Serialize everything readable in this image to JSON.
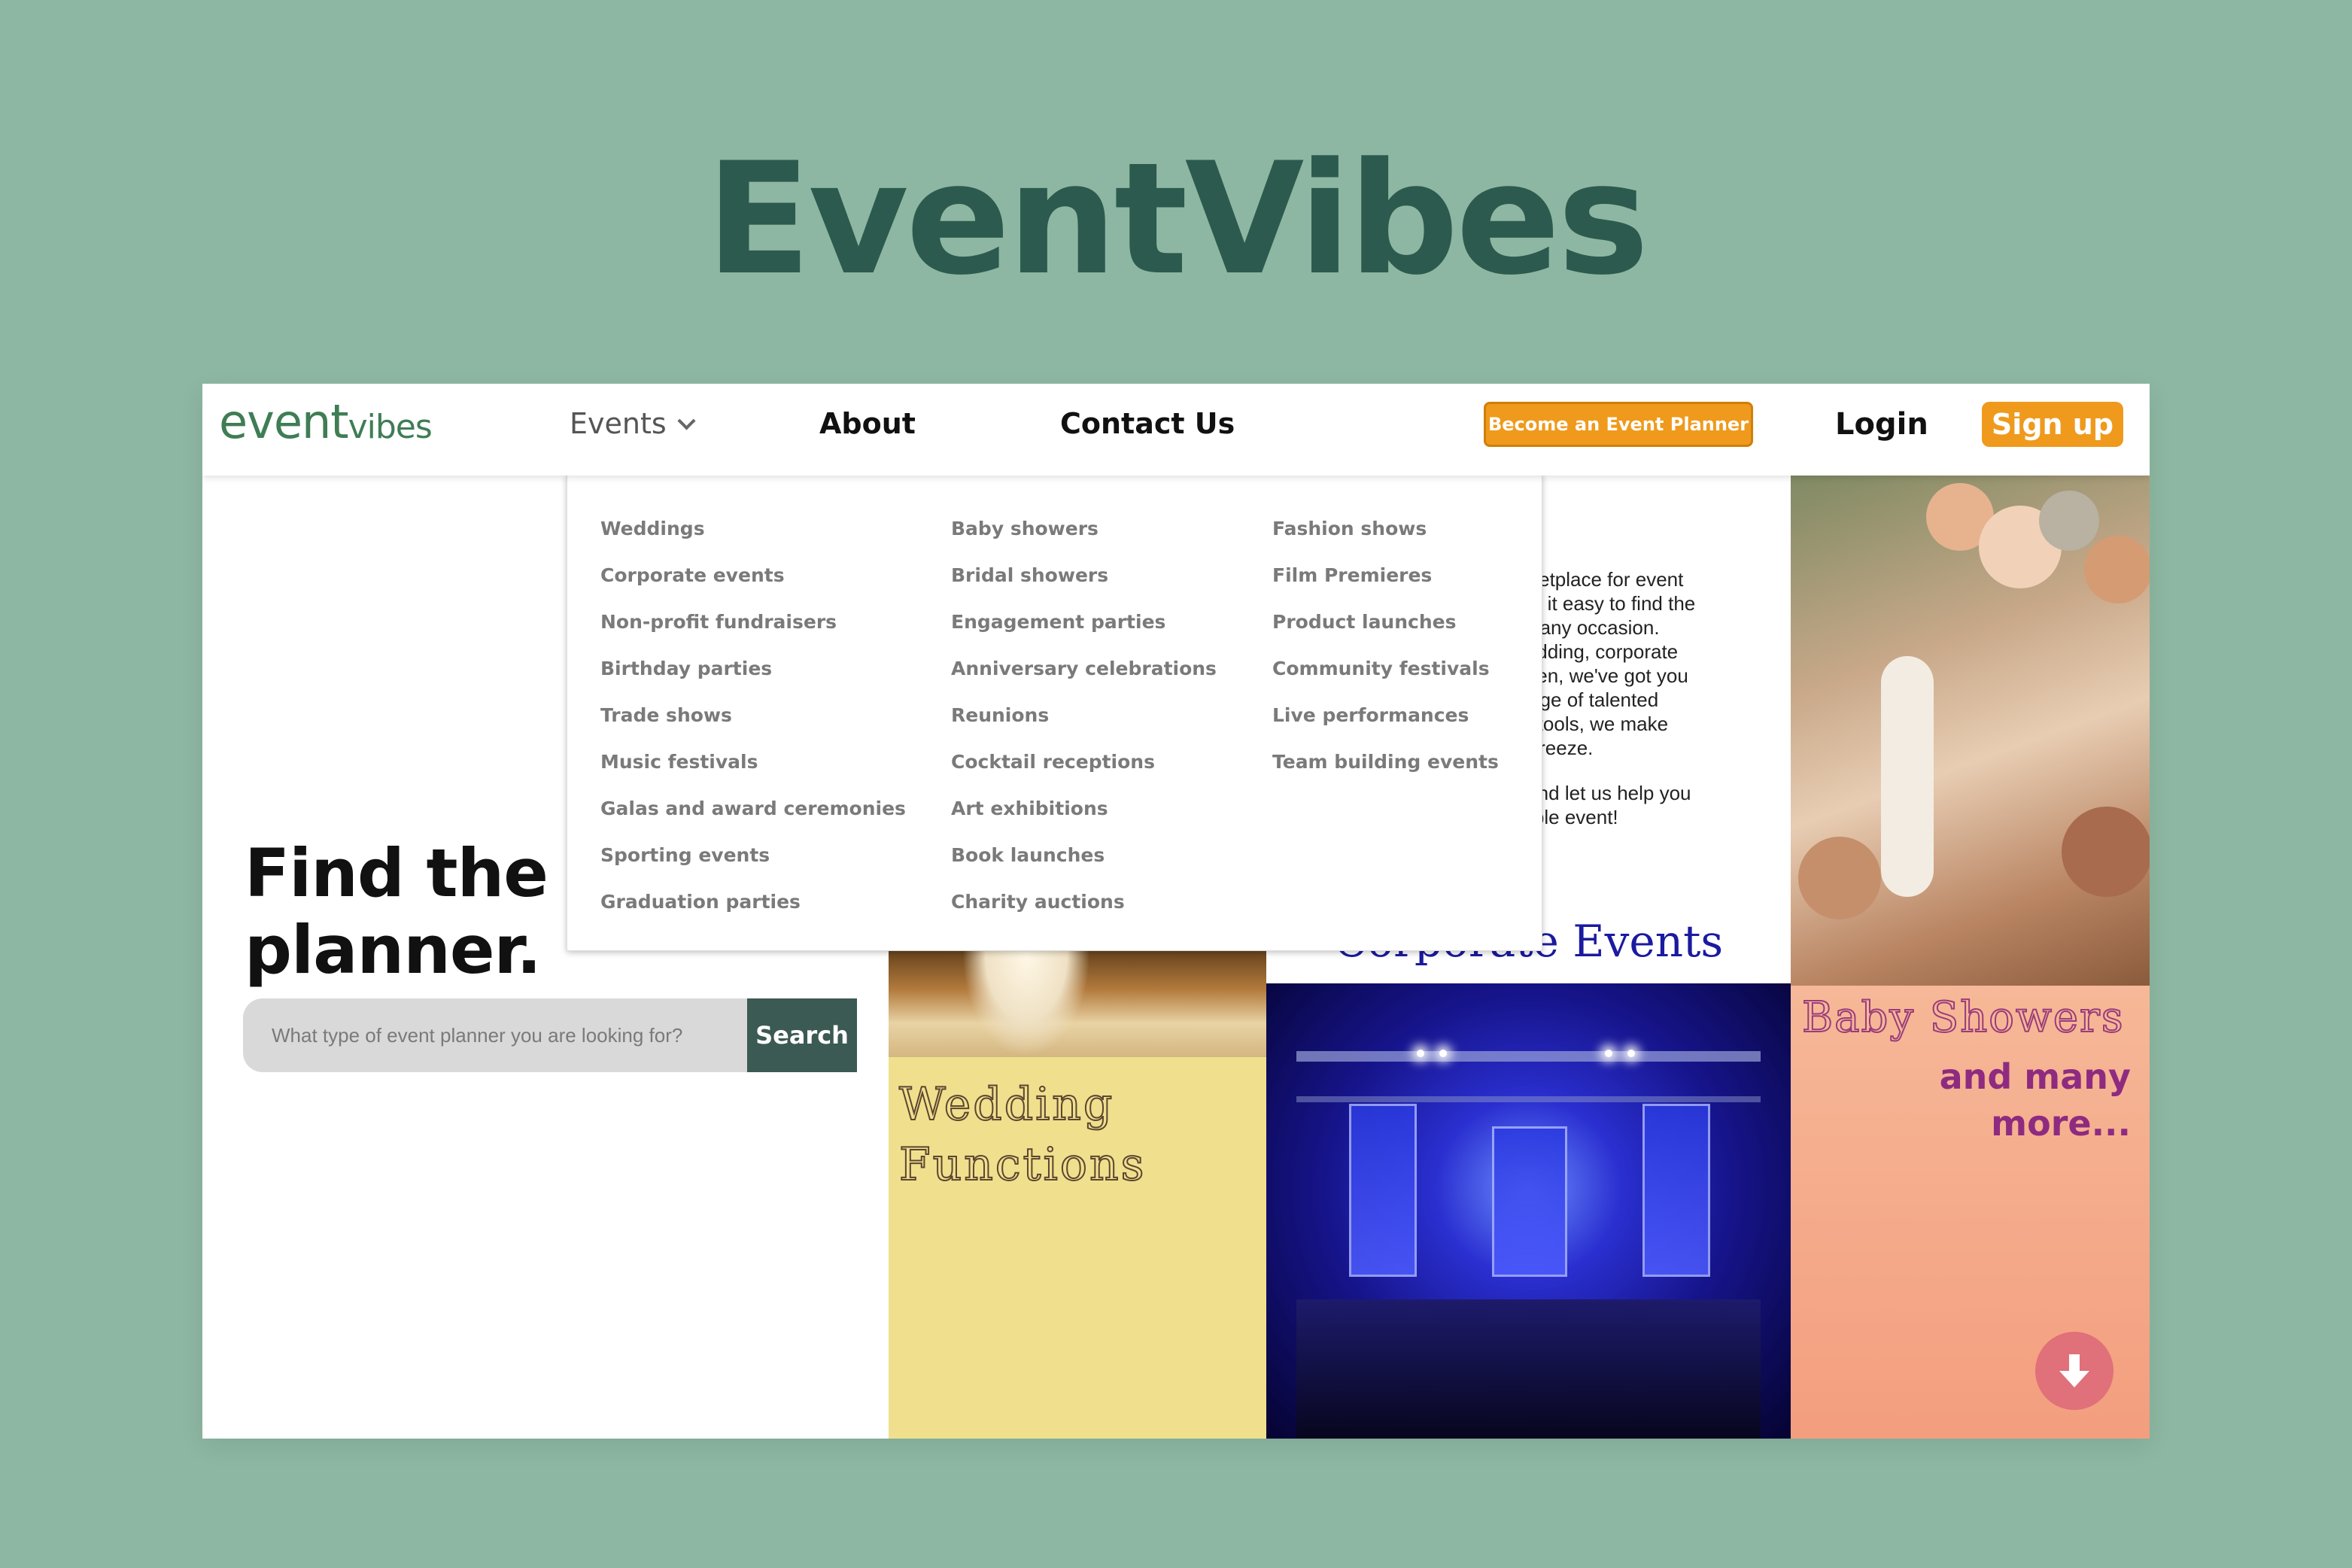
{
  "banner": {
    "title": "EventVibes"
  },
  "nav": {
    "logo_part1": "event",
    "logo_part2": "vibes",
    "events_label": "Events",
    "about_label": "About",
    "contact_label": "Contact Us",
    "planner_button": "Become an Event Planner",
    "login_label": "Login",
    "signup_label": "Sign up",
    "accent_color": "#ef9a1d"
  },
  "dropdown": {
    "col1": [
      "Weddings",
      "Corporate events",
      "Non-profit fundraisers",
      "Birthday parties",
      "Trade shows",
      "Music festivals",
      "Galas and award ceremonies",
      "Sporting events",
      "Graduation parties"
    ],
    "col2": [
      "Baby showers",
      "Bridal showers",
      "Engagement parties",
      "Anniversary celebrations",
      "Reunions",
      "Cocktail receptions",
      "Art exhibitions",
      "Book launches",
      "Charity auctions"
    ],
    "col3": [
      "Fashion shows",
      "Film Premieres",
      "Product launches",
      "Community festivals",
      "Live performances",
      "Team building events"
    ]
  },
  "hero": {
    "headline_line1": "Find the be",
    "headline_line2": "planner.",
    "search_placeholder": "What type of event planner you are looking for?",
    "search_button": "Search"
  },
  "about_text": {
    "lines": [
      "arketplace for event",
      "kes it easy to find the",
      "for any occasion.",
      "wedding, corporate",
      "ween, we've got you",
      "range of talented",
      "se tools, we make",
      "a breeze."
    ],
    "lines2": [
      "y and let us help you",
      "ttable event!"
    ]
  },
  "panels": {
    "wedding_line1": "Wedding",
    "wedding_line2": "Functions",
    "corporate": "Corporate Events",
    "baby_title": "Baby Showers",
    "baby_sub_line1": "and many",
    "baby_sub_line2": "more..."
  }
}
